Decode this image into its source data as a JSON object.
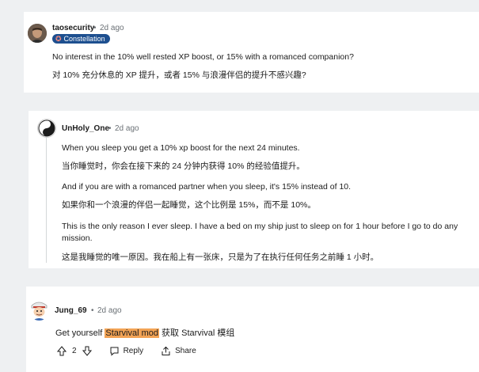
{
  "comments": [
    {
      "username": "taosecurity",
      "separator": "•",
      "time": "2d ago",
      "flair": "Constellation",
      "body_en": "No interest in the 10% well rested XP boost, or 15% with a romanced companion?",
      "body_zh": "对 10% 充分休息的 XP 提升，或者 15% 与浪漫伴侣的提升不感兴趣?"
    },
    {
      "username": "UnHoly_One",
      "separator": "•",
      "time": "2d ago",
      "p1_en": "When you sleep you get a 10% xp boost for the next 24 minutes.",
      "p1_zh": "当你睡觉时，你会在接下来的 24 分钟内获得 10% 的经验值提升。",
      "p2_en": "And if you are with a romanced partner when you sleep, it's 15% instead of 10.",
      "p2_zh": "如果你和一个浪漫的伴侣一起睡觉，这个比例是 15%，而不是 10%。",
      "p3_en": "This is the only reason I ever sleep. I have a bed on my ship just to sleep on for 1 hour before I go to do any mission.",
      "p3_zh": "这是我睡觉的唯一原因。我在船上有一张床，只是为了在执行任何任务之前睡 1 小时。"
    },
    {
      "username": "Jung_69",
      "separator": "•",
      "time": "2d ago",
      "body_prefix": "Get yourself ",
      "body_link": "Starvival mod",
      "body_suffix": " 获取 Starvival 模组",
      "vote_count": "2",
      "reply_label": "Reply",
      "share_label": "Share"
    }
  ],
  "colors": {
    "background": "#eef0f2",
    "flair_bg": "#1d4f8f",
    "highlight": "#f2a355",
    "meta_text": "#6b7176"
  },
  "icons": [
    "upvote-icon",
    "downvote-icon",
    "reply-icon",
    "share-icon",
    "constellation-icon"
  ]
}
